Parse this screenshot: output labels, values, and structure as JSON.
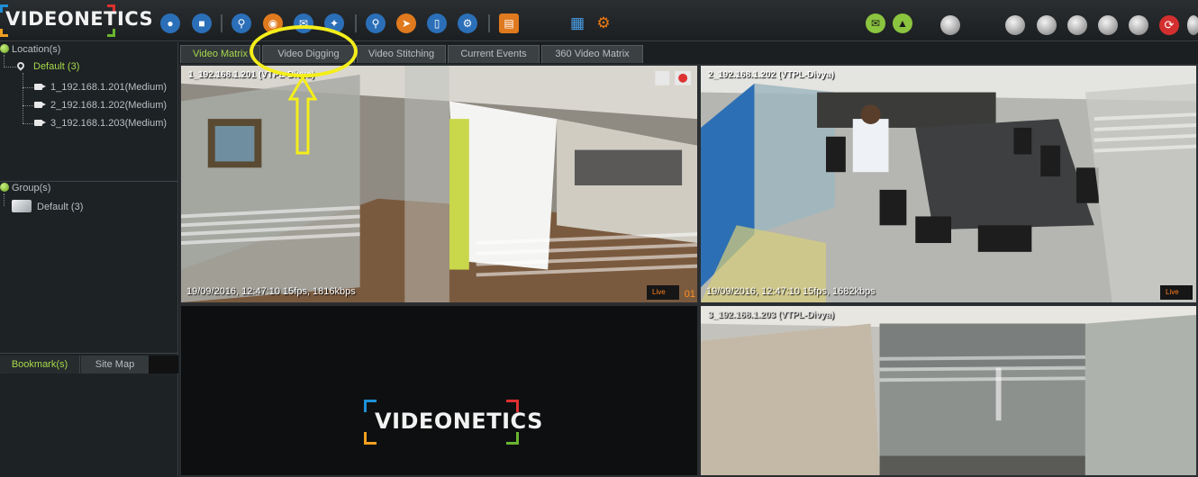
{
  "toolbar": {
    "logo_text": "VIDEONETICS",
    "icons": [
      "user-icon",
      "user-device-icon",
      "search-person-icon",
      "camera-icon",
      "mail-icon",
      "network-icon",
      "search-icon",
      "run-icon",
      "mobile-icon",
      "settings-group-icon",
      "book-icon",
      "grid-icon",
      "gear-icon",
      "mail-alert-icon",
      "bell-icon"
    ]
  },
  "tree": {
    "locations_label": "Location(s)",
    "location_default": "Default (3)",
    "cameras": [
      "1_192.168.1.201(Medium)",
      "2_192.168.1.202(Medium)",
      "3_192.168.1.203(Medium)"
    ],
    "groups_label": "Group(s)",
    "group_default": "Default (3)"
  },
  "bottom_tabs": {
    "bookmarks": "Bookmark(s)",
    "site_map": "Site Map"
  },
  "tabs": [
    "Video Matrix",
    "Video Digging",
    "Video Stitching",
    "Current Events",
    "360 Video Matrix"
  ],
  "tiles": [
    {
      "title": "1_192.168.1.201 (VTPL-Divya)",
      "status": "19/09/2016, 12:47:10  15fps, 1816kbps",
      "live": "Live",
      "num": "01"
    },
    {
      "title": "2_192.168.1.202 (VTPL-Divya)",
      "status": "19/09/2016, 12:47:10  15fps, 1682kbps",
      "live": "Live"
    },
    {
      "title": "3_192.168.1.203 (VTPL-Divya)"
    }
  ],
  "center_logo": "VIDEONETICS",
  "colors": {
    "accent_green": "#a6d84a",
    "annotation_yellow": "#f4ee1a",
    "live_orange": "#ff8020"
  }
}
